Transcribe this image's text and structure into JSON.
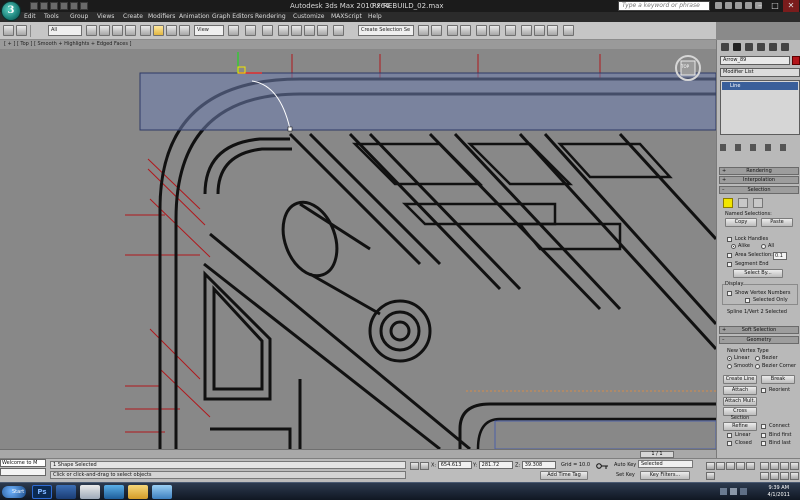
{
  "titlebar": {
    "app_title": "Autodesk 3ds Max  2010 x64",
    "file_title": "RF REBUILD_02.max",
    "search_placeholder": "Type a keyword or phrase"
  },
  "menu": [
    "Edit",
    "Tools",
    "Group",
    "Views",
    "Create",
    "Modifiers",
    "Animation",
    "Graph Editors",
    "Rendering",
    "Customize",
    "MAXScript",
    "Help"
  ],
  "toolbar": {
    "filter_value": "All",
    "refcoord_value": "View",
    "selection_set_placeholder": "Create Selection Se"
  },
  "viewport": {
    "label": "[ + ] [ Top ] [ Smooth + Highlights + Edged Faces ]",
    "viewcube_label": "TOP"
  },
  "command_panel": {
    "object_name": "Arrow_89",
    "object_color": "#b3141a",
    "modifier_list_label": "Modifier List",
    "stack_item": "Line",
    "rollouts": {
      "rendering": "Rendering",
      "interpolation": "Interpolation",
      "selection": "Selection",
      "soft_selection": "Soft Selection",
      "geometry": "Geometry"
    },
    "selection": {
      "named_selections": "Named Selections:",
      "copy": "Copy",
      "paste": "Paste",
      "lock_handles": "Lock Handles",
      "alike": "Alike",
      "all": "All",
      "area_selection": "Area Selection:",
      "area_value": "0.1",
      "segment_end": "Segment End",
      "select_by": "Select By...",
      "display": "Display",
      "show_vertex_numbers": "Show Vertex Numbers",
      "selected_only": "Selected Only",
      "status": "Spline 1/Vert 2 Selected"
    },
    "geometry": {
      "new_vertex_type": "New Vertex Type",
      "linear": "Linear",
      "bezier": "Bezier",
      "smooth": "Smooth",
      "bezier_corner": "Bezier Corner",
      "create_line": "Create Line",
      "break": "Break",
      "attach": "Attach",
      "reorient": "Reorient",
      "attach_mult": "Attach Mult.",
      "cross_section": "Cross Section",
      "refine": "Refine",
      "connect": "Connect",
      "linear2": "Linear",
      "bind_first": "Bind first",
      "closed": "Closed",
      "bind_last": "Bind last"
    }
  },
  "timeslider": {
    "label": "1 / 1"
  },
  "status": {
    "listener_text": "Welcome to M",
    "selection_info": "1 Shape Selected",
    "prompt": "Click or click-and-drag to select objects",
    "x_label": "X:",
    "x_value": "654.613",
    "y_label": "Y:",
    "y_value": "281.72",
    "z_label": "Z:",
    "z_value": "39.308",
    "grid": "Grid = 10.0",
    "add_time_tag": "Add Time Tag",
    "auto_key": "Auto Key",
    "set_key": "Set Key",
    "selected_dropdown": "Selected",
    "key_filters": "Key Filters..."
  },
  "taskbar": {
    "start_label": "Start",
    "ps_label": "Ps",
    "time": "9:39 AM",
    "date": "4/1/2011"
  },
  "colors": {
    "viewport_bg": "#888888",
    "selection_plane": "#6f7fb0",
    "guide_red": "#b0181c",
    "line_black": "#111111"
  }
}
